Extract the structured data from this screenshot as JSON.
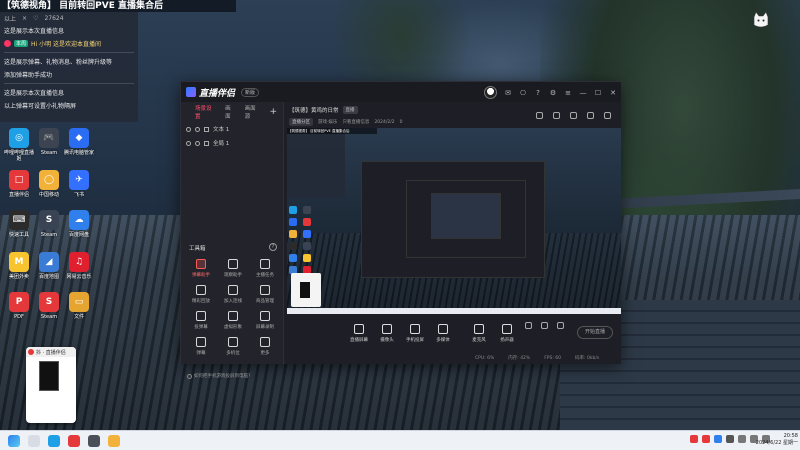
{
  "stream": {
    "title": "【筑德视角】 目前转回PVE 直播集合后",
    "chat": {
      "top": [
        "以上",
        "×",
        "♡",
        "27624"
      ],
      "lines": [
        {
          "badge": "",
          "text": "这是展示本次直播信息"
        },
        {
          "badge": "本周",
          "text": "Hi 小明 这是欢迎本直播间"
        },
        {
          "badge": "",
          "text": "这是展示弹幕、礼物消息、粉丝牌升级等"
        },
        {
          "badge": "",
          "text": "添加弹幕助手成功"
        },
        {
          "badge": "",
          "text": "这是展示本次直播信息"
        },
        {
          "badge": "",
          "text": "以上弹幕可设置小礼物隔屏"
        }
      ]
    }
  },
  "desktop_icons": [
    {
      "label": "哔哩哔哩直播姬",
      "color": "#1fa0e6",
      "glyph": "◎"
    },
    {
      "label": "Steam",
      "color": "#3c4452",
      "glyph": "🎮"
    },
    {
      "label": "腾讯电脑管家",
      "color": "#2b6df2",
      "glyph": "◆"
    },
    {
      "label": "直播伴侣",
      "color": "#e5383b",
      "glyph": "□"
    },
    {
      "label": "中国移动",
      "color": "#f2b138",
      "glyph": "◯"
    },
    {
      "label": "飞书",
      "color": "#3370ff",
      "glyph": "✈"
    },
    {
      "label": "快速工具",
      "color": "#2b2b2b",
      "glyph": "⌨"
    },
    {
      "label": "Steam",
      "color": "#3a4353",
      "glyph": "S"
    },
    {
      "label": "百度网盘",
      "color": "#2f80ed",
      "glyph": "☁"
    },
    {
      "label": "美团外卖",
      "color": "#f7c32e",
      "glyph": "M"
    },
    {
      "label": "百度地图",
      "color": "#3a7bd5",
      "glyph": "◢"
    },
    {
      "label": "网易云音乐",
      "color": "#e0202e",
      "glyph": "♫"
    },
    {
      "label": "PDF",
      "color": "#e5383b",
      "glyph": "P"
    },
    {
      "label": "Steam",
      "color": "#e5383b",
      "glyph": "S"
    },
    {
      "label": "文件",
      "color": "#e5a530",
      "glyph": "▭"
    }
  ],
  "mini_window": {
    "title": "抖 · 直播伴侣"
  },
  "app": {
    "name": "直播伴侣",
    "version": "新版",
    "tabs": [
      "场景设置",
      "画面",
      "画面源"
    ],
    "scenes": [
      "文本 1",
      "全局 1"
    ],
    "tools_title": "工具箱",
    "tools": [
      {
        "label": "弹幕助手",
        "red": true
      },
      {
        "label": "观察助手",
        "red": false
      },
      {
        "label": "主播任务",
        "red": false
      },
      {
        "label": "精彩回放",
        "red": false
      },
      {
        "label": "加入连线",
        "red": false
      },
      {
        "label": "商品管理",
        "red": false
      },
      {
        "label": "投弹幕",
        "red": false
      },
      {
        "label": "虚拟形象",
        "red": false
      },
      {
        "label": "屏幕录制",
        "red": false
      },
      {
        "label": "弹幕",
        "red": false
      },
      {
        "label": "多机位",
        "red": false
      },
      {
        "label": "更多",
        "red": false
      }
    ],
    "footer": "如何把手机游戏投屏到电脑?",
    "room": {
      "title": "【筑德】黄鸡的日常",
      "tag": "直播",
      "row2": [
        "直播分区",
        "游戏·娱乐",
        "只看直播信息",
        "2024/2/2",
        "0"
      ]
    },
    "bottom_tools": [
      "直播屏幕",
      "摄像头",
      "手机投屏",
      "多媒体",
      "麦克风",
      "扬声器"
    ],
    "start_label": "开始直播",
    "status": [
      "CPU: 6%",
      "内存: 42%",
      "FPS: 60",
      "码率: 0kb/s"
    ]
  },
  "taskbar": {
    "time": "20:58",
    "date": "2024/6/22 星期一"
  }
}
